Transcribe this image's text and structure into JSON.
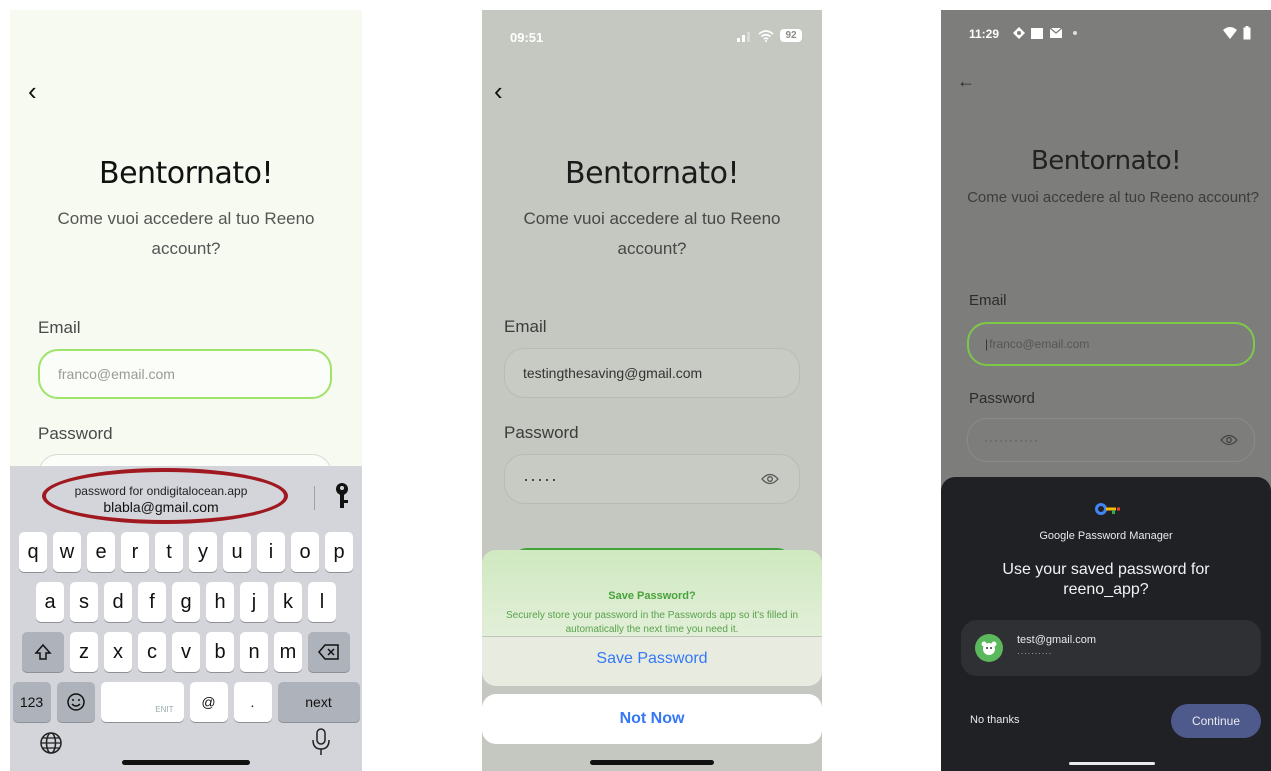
{
  "colors": {
    "accent_green": "#9fe36a",
    "ios_blue": "#3478f6",
    "annotation_red": "#a01820",
    "android_sheet": "#202124",
    "continue_button": "#4e5a8c"
  },
  "screen1": {
    "status_time": "",
    "title": "Bentornato!",
    "subtitle": "Come vuoi accedere al tuo Reeno account?",
    "email_label": "Email",
    "email_placeholder": "franco@email.com",
    "password_label": "Password",
    "keyboard": {
      "suggestion_line1": "password for ondigitalocean.app",
      "suggestion_line2": "blabla@gmail.com",
      "key_icon": "key-icon",
      "row1": [
        "q",
        "w",
        "e",
        "r",
        "t",
        "y",
        "u",
        "i",
        "o",
        "p"
      ],
      "row2": [
        "a",
        "s",
        "d",
        "f",
        "g",
        "h",
        "j",
        "k",
        "l"
      ],
      "row3": [
        "z",
        "x",
        "c",
        "v",
        "b",
        "n",
        "m"
      ],
      "shift_icon": "shift-icon",
      "delete_icon": "delete-icon",
      "numbers_key": "123",
      "emoji_icon": "emoji-icon",
      "space_label": "ENIT",
      "at_key": "@",
      "dot_key": ".",
      "next_key": "next",
      "globe_icon": "globe-icon",
      "mic_icon": "microphone-icon"
    }
  },
  "screen2": {
    "status_time": "09:51",
    "battery": "92",
    "title": "Bentornato!",
    "subtitle": "Come vuoi accedere al tuo Reeno account?",
    "email_label": "Email",
    "email_value": "testingthesaving@gmail.com",
    "password_label": "Password",
    "password_value": "·····",
    "save_sheet": {
      "heading": "Save Password?",
      "body": "Securely store your password in the Passwords app so it's filled in automatically the next time you need it.",
      "save_button": "Save Password",
      "not_now_button": "Not Now"
    }
  },
  "screen3": {
    "status_time": "11:29",
    "title": "Bentornato!",
    "subtitle": "Come vuoi accedere al tuo Reeno account?",
    "email_label": "Email",
    "email_placeholder": "franco@email.com",
    "password_label": "Password",
    "password_value": "···········",
    "password_manager": {
      "name": "Google Password Manager",
      "question": "Use your saved password for reeno_app?",
      "account_email": "test@gmail.com",
      "account_password": "··········",
      "no_thanks": "No thanks",
      "continue": "Continue"
    }
  }
}
